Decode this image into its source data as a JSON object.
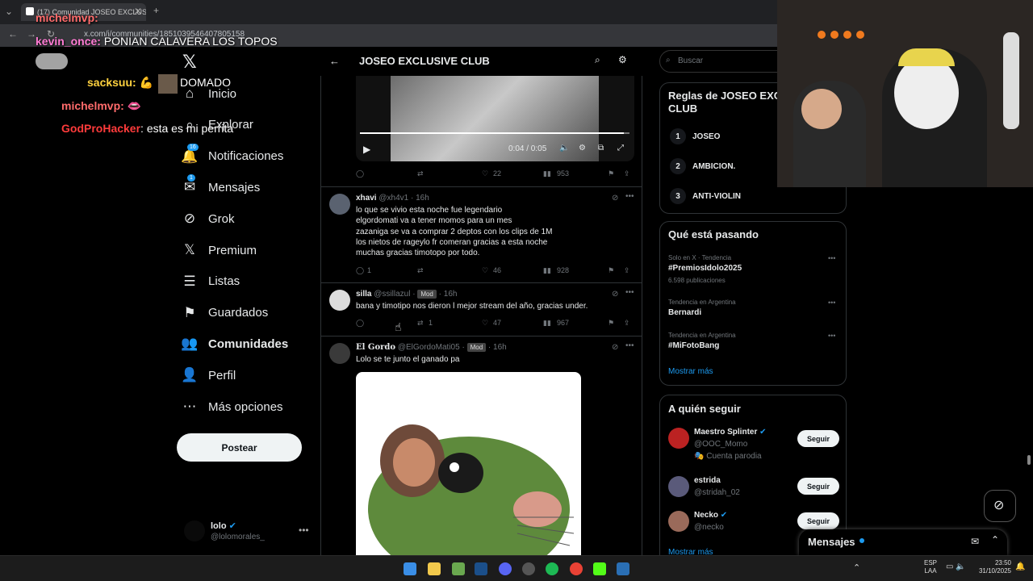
{
  "browser": {
    "tab_title": "(17) Comunidad JOSEO EXCLUS",
    "url": "x.com/i/communities/1851039546407805158"
  },
  "nav": {
    "items": [
      {
        "label": "Inicio",
        "icon": "home-icon"
      },
      {
        "label": "Explorar",
        "icon": "search-icon"
      },
      {
        "label": "Notificaciones",
        "icon": "bell-icon",
        "badge": "16"
      },
      {
        "label": "Mensajes",
        "icon": "mail-icon",
        "badge": "1"
      },
      {
        "label": "Grok",
        "icon": "grok-icon"
      },
      {
        "label": "Premium",
        "icon": "x-logo-icon"
      },
      {
        "label": "Listas",
        "icon": "list-icon"
      },
      {
        "label": "Guardados",
        "icon": "bookmark-icon"
      },
      {
        "label": "Comunidades",
        "icon": "people-icon"
      },
      {
        "label": "Perfil",
        "icon": "person-icon"
      },
      {
        "label": "Más opciones",
        "icon": "more-circle-icon"
      }
    ],
    "post_label": "Postear",
    "account_name": "lolo",
    "account_handle": "@lolomorales_"
  },
  "header": {
    "title": "JOSEO EXCLUSIVE CLUB"
  },
  "video": {
    "time": "0:04 / 0:05",
    "progress": 0.98
  },
  "tweets": [
    {
      "actions": {
        "replies": "",
        "retweets": "",
        "likes": "22",
        "views": "953"
      }
    },
    {
      "name": "xhavi",
      "handle": "@xh4v1",
      "time": "16h",
      "lines": [
        "lo que se vivio esta noche fue legendario",
        "elgordomati va a tener momos para un mes",
        "zazaniga se va a comprar 2 deptos con los clips de 1M",
        "los nietos de rageylo fr comeran gracias a esta noche",
        "muchas gracias timotopo por todo."
      ],
      "actions": {
        "replies": "1",
        "retweets": "",
        "likes": "46",
        "views": "928"
      }
    },
    {
      "name": "silla",
      "handle": "@ssillazul",
      "badge": "Mod",
      "time": "16h",
      "lines": [
        "bana y timotipo nos dieron l mejor stream del año, gracias under."
      ],
      "actions": {
        "replies": "",
        "retweets": "1",
        "likes": "47",
        "views": "967"
      }
    },
    {
      "name": "El Gordo",
      "handle": "@ElGordoMati05",
      "badge": "Mod",
      "time": "16h",
      "lines": [
        "Lolo se te junto el ganado pa"
      ]
    }
  ],
  "right": {
    "search_placeholder": "Buscar",
    "rules_title_1": "Reglas de JOSEO EXC",
    "rules_title_2": "CLUB",
    "rules": [
      {
        "num": "1",
        "text": "JOSEO"
      },
      {
        "num": "2",
        "text": "AMBICION."
      },
      {
        "num": "3",
        "text": "ANTI-VIOLIN"
      }
    ],
    "trends_title": "Qué está pasando",
    "trends": [
      {
        "meta": "Solo en X · Tendencia",
        "name": "#PremiosIdolo2025",
        "count": "6.598 publicaciones"
      },
      {
        "meta": "Tendencia en Argentina",
        "name": "Bernardi",
        "count": ""
      },
      {
        "meta": "Tendencia en Argentina",
        "name": "#MiFotoBang",
        "count": ""
      }
    ],
    "show_more": "Mostrar más",
    "follow_title": "A quién seguir",
    "follow": [
      {
        "name": "Maestro Splinter",
        "handle": "@OOC_Momo",
        "note": "Cuenta parodia",
        "verified": true
      },
      {
        "name": "estrida",
        "handle": "@stridah_02",
        "note": "",
        "verified": false
      },
      {
        "name": "Necko",
        "handle": "@necko",
        "note": "",
        "verified": true
      }
    ],
    "follow_label": "Seguir",
    "follow_more": "Mostrar más"
  },
  "messages_dock": {
    "label": "Mensajes"
  },
  "chat": [
    {
      "user": "michelmvp:",
      "text": "",
      "color": "#ff6b6b"
    },
    {
      "user": "kevin_once:",
      "text": " PONIAN CALAVERA LOS TOPOS",
      "color": "#ff7bd3"
    },
    {
      "user": "sacksuu:",
      "text": "",
      "color": "#ffd23f"
    },
    {
      "user": "",
      "text": "DOMADO",
      "color": "#ffffff"
    },
    {
      "user": "michelmvp:",
      "text": "",
      "color": "#ff6b6b"
    },
    {
      "user": "GodProHacker",
      "text": ": esta es mi perrita",
      "color": "#ff3b3b"
    }
  ],
  "taskbar": {
    "lang": "ESP",
    "layout": "LAA",
    "time": "23:50",
    "date": "31/10/2025"
  }
}
